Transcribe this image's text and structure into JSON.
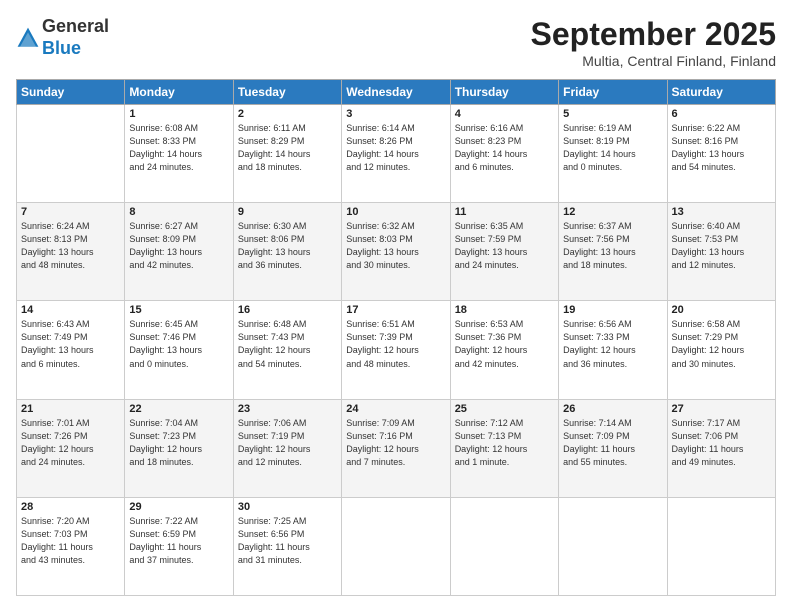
{
  "logo": {
    "general": "General",
    "blue": "Blue"
  },
  "header": {
    "month": "September 2025",
    "location": "Multia, Central Finland, Finland"
  },
  "weekdays": [
    "Sunday",
    "Monday",
    "Tuesday",
    "Wednesday",
    "Thursday",
    "Friday",
    "Saturday"
  ],
  "weeks": [
    [
      {
        "day": "",
        "info": ""
      },
      {
        "day": "1",
        "info": "Sunrise: 6:08 AM\nSunset: 8:33 PM\nDaylight: 14 hours\nand 24 minutes."
      },
      {
        "day": "2",
        "info": "Sunrise: 6:11 AM\nSunset: 8:29 PM\nDaylight: 14 hours\nand 18 minutes."
      },
      {
        "day": "3",
        "info": "Sunrise: 6:14 AM\nSunset: 8:26 PM\nDaylight: 14 hours\nand 12 minutes."
      },
      {
        "day": "4",
        "info": "Sunrise: 6:16 AM\nSunset: 8:23 PM\nDaylight: 14 hours\nand 6 minutes."
      },
      {
        "day": "5",
        "info": "Sunrise: 6:19 AM\nSunset: 8:19 PM\nDaylight: 14 hours\nand 0 minutes."
      },
      {
        "day": "6",
        "info": "Sunrise: 6:22 AM\nSunset: 8:16 PM\nDaylight: 13 hours\nand 54 minutes."
      }
    ],
    [
      {
        "day": "7",
        "info": "Sunrise: 6:24 AM\nSunset: 8:13 PM\nDaylight: 13 hours\nand 48 minutes."
      },
      {
        "day": "8",
        "info": "Sunrise: 6:27 AM\nSunset: 8:09 PM\nDaylight: 13 hours\nand 42 minutes."
      },
      {
        "day": "9",
        "info": "Sunrise: 6:30 AM\nSunset: 8:06 PM\nDaylight: 13 hours\nand 36 minutes."
      },
      {
        "day": "10",
        "info": "Sunrise: 6:32 AM\nSunset: 8:03 PM\nDaylight: 13 hours\nand 30 minutes."
      },
      {
        "day": "11",
        "info": "Sunrise: 6:35 AM\nSunset: 7:59 PM\nDaylight: 13 hours\nand 24 minutes."
      },
      {
        "day": "12",
        "info": "Sunrise: 6:37 AM\nSunset: 7:56 PM\nDaylight: 13 hours\nand 18 minutes."
      },
      {
        "day": "13",
        "info": "Sunrise: 6:40 AM\nSunset: 7:53 PM\nDaylight: 13 hours\nand 12 minutes."
      }
    ],
    [
      {
        "day": "14",
        "info": "Sunrise: 6:43 AM\nSunset: 7:49 PM\nDaylight: 13 hours\nand 6 minutes."
      },
      {
        "day": "15",
        "info": "Sunrise: 6:45 AM\nSunset: 7:46 PM\nDaylight: 13 hours\nand 0 minutes."
      },
      {
        "day": "16",
        "info": "Sunrise: 6:48 AM\nSunset: 7:43 PM\nDaylight: 12 hours\nand 54 minutes."
      },
      {
        "day": "17",
        "info": "Sunrise: 6:51 AM\nSunset: 7:39 PM\nDaylight: 12 hours\nand 48 minutes."
      },
      {
        "day": "18",
        "info": "Sunrise: 6:53 AM\nSunset: 7:36 PM\nDaylight: 12 hours\nand 42 minutes."
      },
      {
        "day": "19",
        "info": "Sunrise: 6:56 AM\nSunset: 7:33 PM\nDaylight: 12 hours\nand 36 minutes."
      },
      {
        "day": "20",
        "info": "Sunrise: 6:58 AM\nSunset: 7:29 PM\nDaylight: 12 hours\nand 30 minutes."
      }
    ],
    [
      {
        "day": "21",
        "info": "Sunrise: 7:01 AM\nSunset: 7:26 PM\nDaylight: 12 hours\nand 24 minutes."
      },
      {
        "day": "22",
        "info": "Sunrise: 7:04 AM\nSunset: 7:23 PM\nDaylight: 12 hours\nand 18 minutes."
      },
      {
        "day": "23",
        "info": "Sunrise: 7:06 AM\nSunset: 7:19 PM\nDaylight: 12 hours\nand 12 minutes."
      },
      {
        "day": "24",
        "info": "Sunrise: 7:09 AM\nSunset: 7:16 PM\nDaylight: 12 hours\nand 7 minutes."
      },
      {
        "day": "25",
        "info": "Sunrise: 7:12 AM\nSunset: 7:13 PM\nDaylight: 12 hours\nand 1 minute."
      },
      {
        "day": "26",
        "info": "Sunrise: 7:14 AM\nSunset: 7:09 PM\nDaylight: 11 hours\nand 55 minutes."
      },
      {
        "day": "27",
        "info": "Sunrise: 7:17 AM\nSunset: 7:06 PM\nDaylight: 11 hours\nand 49 minutes."
      }
    ],
    [
      {
        "day": "28",
        "info": "Sunrise: 7:20 AM\nSunset: 7:03 PM\nDaylight: 11 hours\nand 43 minutes."
      },
      {
        "day": "29",
        "info": "Sunrise: 7:22 AM\nSunset: 6:59 PM\nDaylight: 11 hours\nand 37 minutes."
      },
      {
        "day": "30",
        "info": "Sunrise: 7:25 AM\nSunset: 6:56 PM\nDaylight: 11 hours\nand 31 minutes."
      },
      {
        "day": "",
        "info": ""
      },
      {
        "day": "",
        "info": ""
      },
      {
        "day": "",
        "info": ""
      },
      {
        "day": "",
        "info": ""
      }
    ]
  ]
}
